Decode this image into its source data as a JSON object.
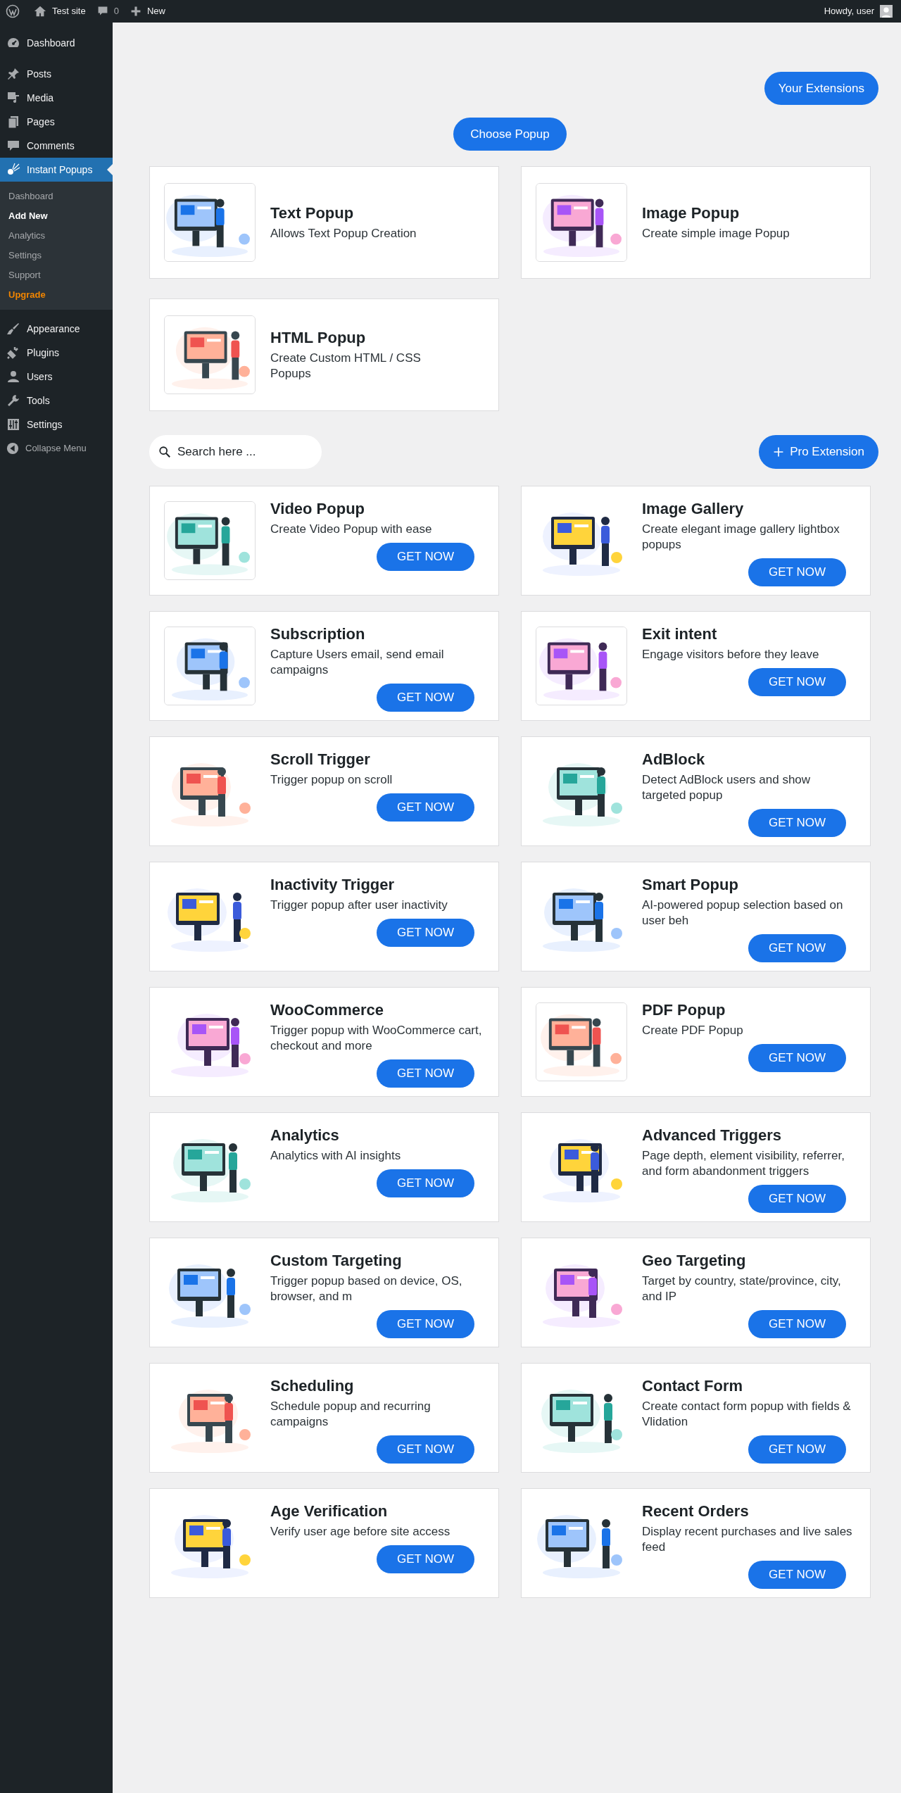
{
  "admin_bar": {
    "site": "Test site",
    "comments": "0",
    "new": "New",
    "greeting": "Howdy, user"
  },
  "sidebar": {
    "items": [
      {
        "label": "Dashboard",
        "selected": false
      },
      {
        "label": "Posts",
        "selected": false
      },
      {
        "label": "Media",
        "selected": false
      },
      {
        "label": "Pages",
        "selected": false
      },
      {
        "label": "Comments",
        "selected": false
      },
      {
        "label": "Instant Popups",
        "selected": true,
        "children": [
          {
            "label": "Dashboard",
            "selected": false,
            "kind": "link"
          },
          {
            "label": "Add New",
            "selected": true,
            "kind": "link"
          },
          {
            "label": "Analytics",
            "selected": false,
            "kind": "link"
          },
          {
            "label": "Settings",
            "selected": false,
            "kind": "link"
          },
          {
            "label": "Support",
            "selected": false,
            "kind": "link"
          },
          {
            "label": "Upgrade",
            "selected": false,
            "kind": "upgrade"
          }
        ]
      },
      {
        "label": "Appearance",
        "selected": false
      },
      {
        "label": "Plugins",
        "selected": false
      },
      {
        "label": "Users",
        "selected": false
      },
      {
        "label": "Tools",
        "selected": false
      },
      {
        "label": "Settings",
        "selected": false
      }
    ],
    "collapse": "Collapse Menu"
  },
  "header": {
    "extensions_button": "Your Extensions",
    "choose_button": "Choose Popup"
  },
  "popup_types": [
    {
      "title": "Text Popup",
      "description": "Allows Text Popup Creation",
      "image": {
        "kind": "picture",
        "framed": true
      }
    },
    {
      "title": "Image Popup",
      "description": "Create simple image Popup",
      "image": {
        "kind": "picture",
        "framed": true
      }
    },
    {
      "title": "HTML Popup",
      "description": "Create Custom HTML / CSS Popups",
      "image": {
        "kind": "picture",
        "framed": true
      }
    }
  ],
  "search": {
    "placeholder": "Search here ..."
  },
  "pro_button": "Pro Extension",
  "extensions": [
    {
      "title": "Video Popup",
      "description": "Create Video Popup with ease",
      "image": {
        "kind": "picture",
        "framed": true
      },
      "button": "GET NOW"
    },
    {
      "title": "Image Gallery",
      "description": "Create elegant image gallery lightbox popups",
      "image": {
        "kind": "picture",
        "framed": false
      },
      "button": "GET NOW"
    },
    {
      "title": "Subscription",
      "description": "Capture Users email, send email campaigns",
      "image": {
        "kind": "picture",
        "framed": true
      },
      "button": "GET NOW"
    },
    {
      "title": "Exit intent",
      "description": "Engage visitors before they leave",
      "image": {
        "kind": "picture",
        "framed": true
      },
      "button": "GET NOW"
    },
    {
      "title": "Scroll Trigger",
      "description": "Trigger popup on scroll",
      "image": {
        "kind": "picture",
        "framed": false
      },
      "button": "GET NOW"
    },
    {
      "title": "AdBlock",
      "description": "Detect AdBlock users and show targeted popup",
      "image": {
        "kind": "picture",
        "framed": false
      },
      "button": "GET NOW"
    },
    {
      "title": "Inactivity Trigger",
      "description": "Trigger popup after user inactivity",
      "image": {
        "kind": "picture",
        "framed": false
      },
      "button": "GET NOW"
    },
    {
      "title": "Smart Popup",
      "description": "AI-powered popup selection based on user beh",
      "image": {
        "kind": "picture",
        "framed": false
      },
      "button": "GET NOW"
    },
    {
      "title": "WooCommerce",
      "description": "Trigger popup with WooCommerce cart, checkout and more",
      "image": {
        "kind": "picture",
        "framed": false
      },
      "button": "GET NOW"
    },
    {
      "title": "PDF Popup",
      "description": "Create PDF Popup",
      "image": {
        "kind": "picture",
        "framed": true
      },
      "button": "GET NOW"
    },
    {
      "title": "Analytics",
      "description": "Analytics with AI insights",
      "image": {
        "kind": "picture",
        "framed": false
      },
      "button": "GET NOW"
    },
    {
      "title": "Advanced Triggers",
      "description": "Page depth, element visibility, referrer, and form abandonment triggers",
      "image": {
        "kind": "picture",
        "framed": false
      },
      "button": "GET NOW"
    },
    {
      "title": "Custom Targeting",
      "description": "Trigger popup based on device, OS, browser, and m",
      "image": {
        "kind": "picture",
        "framed": false
      },
      "button": "GET NOW"
    },
    {
      "title": "Geo Targeting",
      "description": "Target by country, state/province, city, and IP",
      "image": {
        "kind": "picture",
        "framed": false
      },
      "button": "GET NOW"
    },
    {
      "title": "Scheduling",
      "description": "Schedule popup and recurring campaigns",
      "image": {
        "kind": "picture",
        "framed": false
      },
      "button": "GET NOW"
    },
    {
      "title": "Contact Form",
      "description": "Create contact form popup with fields & Vlidation",
      "image": {
        "kind": "picture",
        "framed": false
      },
      "button": "GET NOW"
    },
    {
      "title": "Age Verification",
      "description": "Verify user age before site access",
      "image": {
        "kind": "picture",
        "framed": false
      },
      "button": "GET NOW"
    },
    {
      "title": "Recent Orders",
      "description": "Display recent purchases and live sales feed",
      "image": {
        "kind": "picture",
        "framed": false
      },
      "button": "GET NOW"
    }
  ]
}
